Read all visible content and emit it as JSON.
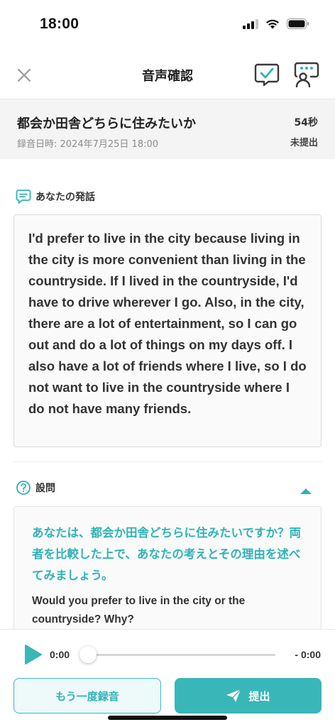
{
  "status_bar": {
    "time": "18:00"
  },
  "nav": {
    "title": "音声確認",
    "icons": [
      "close-icon",
      "checklist-chat-icon",
      "feedback-person-icon"
    ]
  },
  "topic": {
    "title": "都会か田舎どちらに住みたいか",
    "date": "録音日時: 2024年7月25日 18:00",
    "duration": "54秒",
    "status": "未提出"
  },
  "speech": {
    "label": "あなたの発話",
    "text": "I'd prefer to live in the city because living in the city is more convenient than living in the countryside. If I lived in the countryside, I'd have to drive wherever I go. Also, in the city, there are a lot of entertainment, so I can go out and do a lot of things on my days off. I also have a lot of friends where I live, so I do not want to live in the countryside where I do not have many friends."
  },
  "question": {
    "label": "設問",
    "jp": "あなたは、都会か田舎どちらに住みたいですか？両者を比較した上で、あなたの考えとその理由を述べてみましょう。",
    "en": "Would you prefer to live in the city or the countryside? Why?"
  },
  "player": {
    "current": "0:00",
    "remaining": "- 0:00",
    "progress": 0
  },
  "actions": {
    "rerecord": "もう一度録音",
    "submit": "提出"
  },
  "colors": {
    "accent": "#39b6b8",
    "accent_text": "#2fb3b6",
    "header_bg": "#f4f4f4"
  }
}
